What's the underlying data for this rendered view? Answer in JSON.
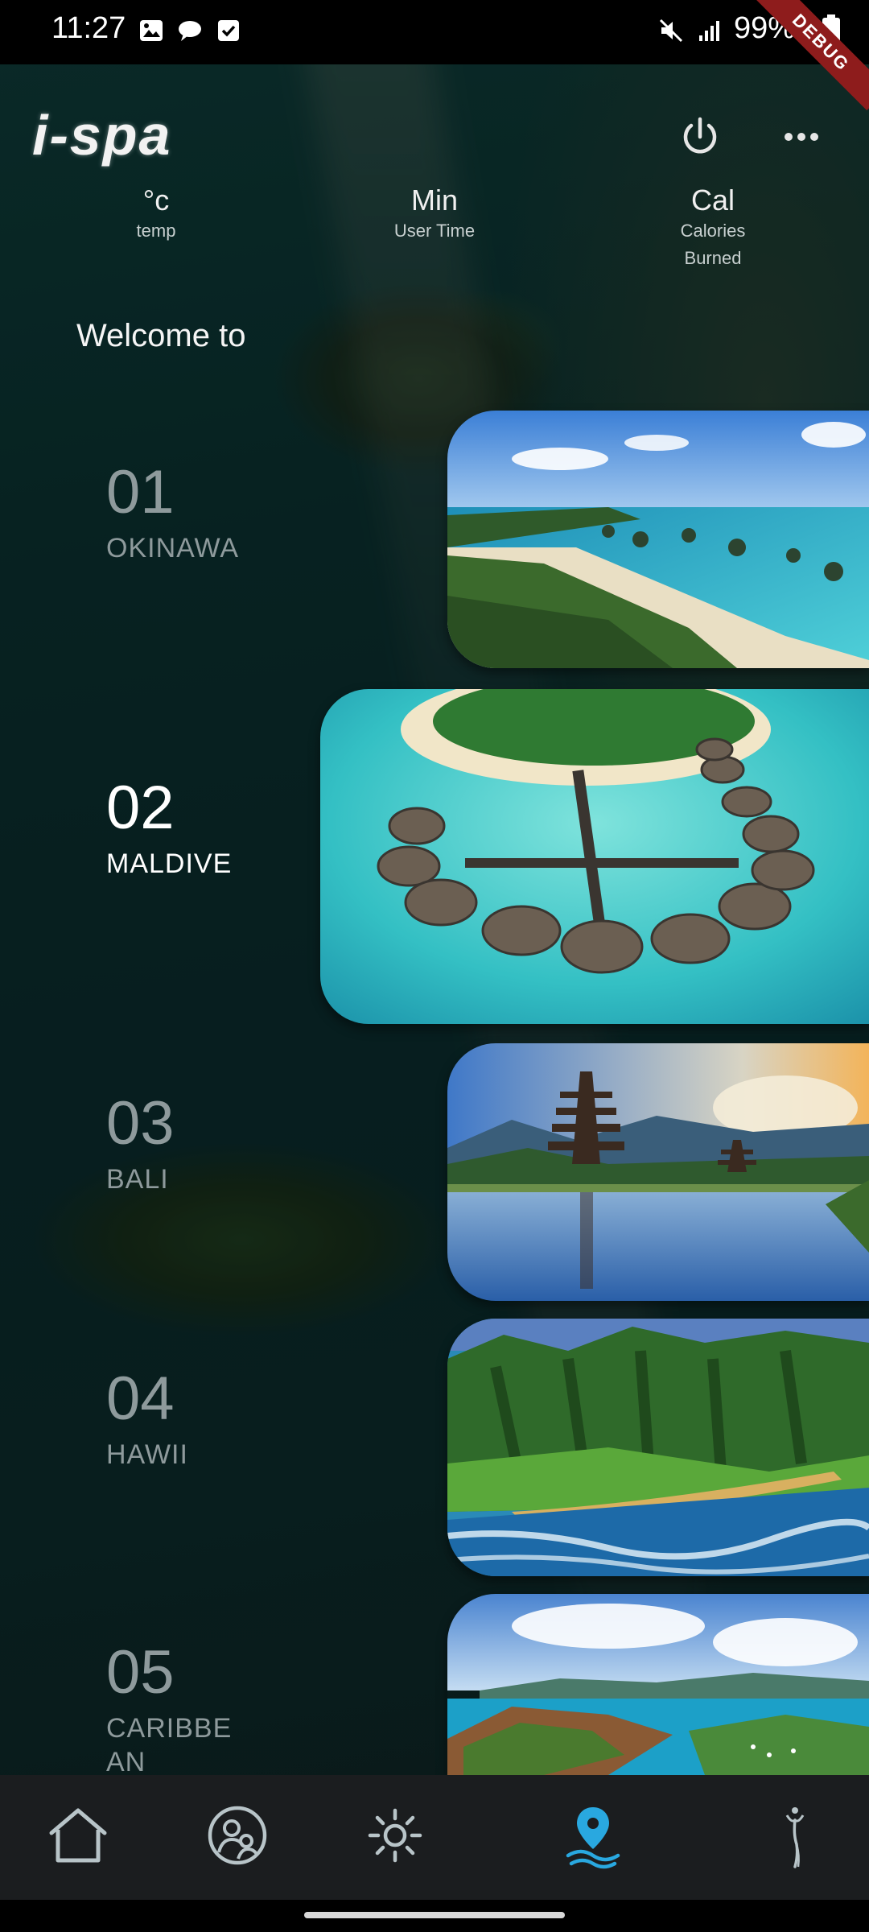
{
  "status_bar": {
    "time": "11:27",
    "battery": "99%",
    "debug_label": "DEBUG"
  },
  "header": {
    "logo": "i-spa",
    "power_icon": "power-icon",
    "more_icon": "more-horizontal-icon"
  },
  "stats": [
    {
      "value": "°c",
      "label": "temp"
    },
    {
      "value": "Min",
      "label": "User Time"
    },
    {
      "value": "Cal",
      "label": "Calories Burned"
    }
  ],
  "welcome": "Welcome to",
  "destinations": [
    {
      "number": "01",
      "name": "OKINAWA"
    },
    {
      "number": "02",
      "name": "MALDIVE"
    },
    {
      "number": "03",
      "name": "BALI"
    },
    {
      "number": "04",
      "name": "HAWII"
    },
    {
      "number": "05",
      "name": "CARIBBEAN"
    }
  ],
  "bottom_nav": [
    {
      "icon": "home-icon"
    },
    {
      "icon": "users-icon"
    },
    {
      "icon": "light-icon"
    },
    {
      "icon": "location-icon",
      "active": true
    },
    {
      "icon": "figure-icon"
    }
  ],
  "colors": {
    "accent": "#29a8e0",
    "nav_bg": "#1b1d1f",
    "debug_ribbon": "#8e1c1c"
  }
}
